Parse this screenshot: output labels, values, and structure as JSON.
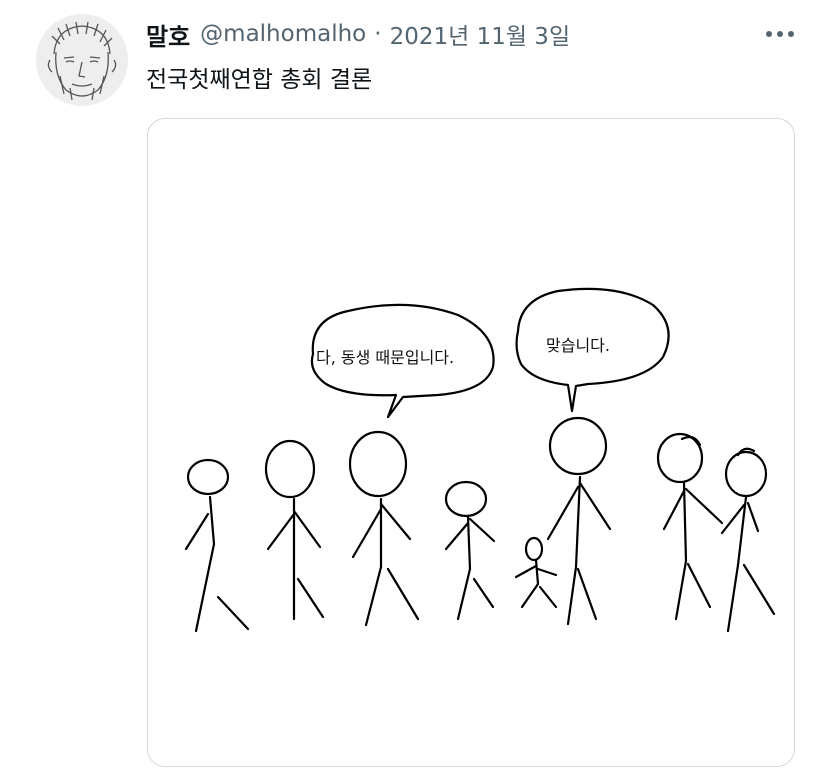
{
  "tweet": {
    "display_name": "말호",
    "handle": "@malhomalho",
    "separator": "·",
    "date": "2021년 11월 3일",
    "text": "전국첫째연합 총회 결론",
    "more_icon": "more-horizontal-icon"
  },
  "comic": {
    "bubble_left": "다, 동생 때문입니다.",
    "bubble_right": "맞습니다."
  },
  "colors": {
    "text_primary": "#0f1419",
    "text_secondary": "#536471",
    "border": "#cfd9de"
  }
}
